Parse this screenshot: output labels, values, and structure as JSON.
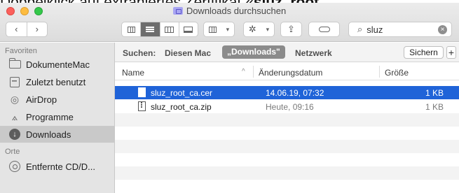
{
  "caption": {
    "text": "Doppelklick auf extrahiertes Zertifikat «",
    "bold": "sluz_root_"
  },
  "window": {
    "title": "Downloads durchsuchen",
    "nav": {
      "back": "‹",
      "forward": "›"
    },
    "search": {
      "value": "sluz",
      "clear": "×"
    }
  },
  "sidebar": {
    "favorites_heading": "Favoriten",
    "favorites": [
      {
        "label": "DokumenteMac",
        "icon": "folder-icon"
      },
      {
        "label": "Zuletzt benutzt",
        "icon": "recent-icon"
      },
      {
        "label": "AirDrop",
        "icon": "airdrop-icon"
      },
      {
        "label": "Programme",
        "icon": "applications-icon"
      },
      {
        "label": "Downloads",
        "icon": "downloads-icon",
        "selected": true
      }
    ],
    "places_heading": "Orte",
    "places": [
      {
        "label": "Entfernte CD/D...",
        "icon": "disc-icon"
      }
    ]
  },
  "scope": {
    "label": "Suchen:",
    "options": [
      "Diesen Mac",
      "„Downloads\"",
      "Netzwerk"
    ],
    "selected": "„Downloads\"",
    "save": "Sichern",
    "add": "+"
  },
  "columns": {
    "name": "Name",
    "date": "Änderungsdatum",
    "size": "Größe"
  },
  "files": [
    {
      "name": "sluz_root_ca.cer",
      "date": "14.06.19, 07:32",
      "size": "1 KB",
      "selected": true
    },
    {
      "name": "sluz_root_ca.zip",
      "date": "Heute, 09:16",
      "size": "1 KB",
      "selected": false
    }
  ],
  "colors": {
    "selection": "#1f63d8",
    "sidebar": "#e4e4e4"
  }
}
